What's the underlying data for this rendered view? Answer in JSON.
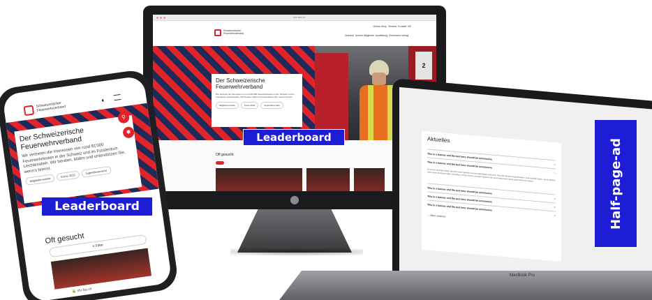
{
  "desktop": {
    "browser_url": "sfv-fss.ch",
    "logo_text": "Schweizerischer Feuerwehrverband",
    "top_links": [
      "Online-Shop",
      "Termine",
      "Kontakt",
      "DE"
    ],
    "main_nav": [
      "Verband",
      "Unsere Mitglieder",
      "Ausbildung",
      "Feuerwehr-Verlag"
    ],
    "hero_title": "Der Schweizerische Feuerwehrverband",
    "hero_text": "Wir vertreten die Interessen von rund 81'000 Feuerwehrleuten in der Schweiz und im Fürstentum Liechtenstein. Wir beraten, bilden und unterstützen Sie, wenn's brennt.",
    "hero_chips": [
      "Mitgliedervorteile",
      "Kurse 2023",
      "Jugendfeuerwehr"
    ],
    "panel_number": "2",
    "oft_gesucht": "Oft gesucht",
    "leaderboard": "Leaderboard"
  },
  "laptop": {
    "section_title": "Aktuelles",
    "rows": [
      {
        "title": "This is a banner and the text here should be unintrusive",
        "icon": "+"
      },
      {
        "title": "This is a banner and the text here should be unintrusive",
        "icon": "−"
      },
      {
        "title": "This is a banner and the text here should be unintrusive",
        "icon": "+"
      },
      {
        "title": "This is a banner and the text here should be unintrusive",
        "icon": "+"
      },
      {
        "title": "This is a banner and the text here should be unintrusive",
        "icon": "+"
      }
    ],
    "expanded_text": "Es war ein klirrender Winter, die Seen waren gefroren und die Vögel flogen nicht mehr. Die Kälte ließ die Feuerwehrleute in ihren Stiefeln frieren, als ein schriller Alarm durch die Wache hallte. Sie griffen zu ihren Helmen und eilten hinaus in die verschneite Nacht, bereit, jedem Brand zu trotzen.",
    "more_link": "Mehr erfahren",
    "device_label": "MacBook Pro",
    "half_page_ad": "Half-page-ad"
  },
  "phone": {
    "logo_text": "Schweizerischer Feuerwehrverband",
    "hero_title": "Der Schweizerische Feuerwehrverband",
    "hero_text": "Wir vertreten die Interessen von rund 81'000 Feuerwehrleuten in der Schweiz und im Fürstentum Liechtenstein. Wir beraten, bilden und unterstützen Sie, wenn's brennt.",
    "hero_chips": [
      "Mitgliedervorteile",
      "Kurse 2023",
      "Jugendfeuerwehr"
    ],
    "leaderboard": "Leaderboard",
    "oft_gesucht": "Oft gesucht",
    "filter_label": "Filter",
    "url": "sfv-fss.ch"
  },
  "colors": {
    "brand_red": "#e1242c",
    "navy": "#1e2a57",
    "ad_blue": "#1d1dd6"
  }
}
